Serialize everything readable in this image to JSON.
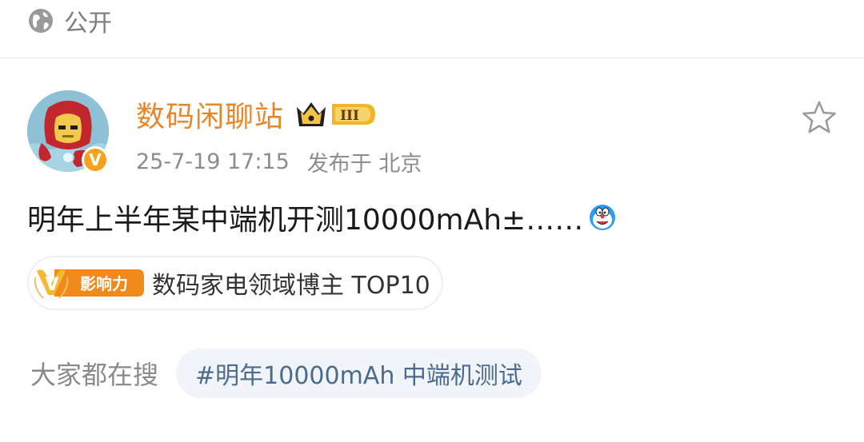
{
  "visibility": {
    "icon": "globe-icon",
    "label": "公开"
  },
  "post": {
    "author": {
      "name": "数码闲聊站",
      "avatar": "iron-man-avatar",
      "verified_icon": "verified-v-icon",
      "verified_mark": "V",
      "rank_badge_icon": "crown-rank-badge-icon",
      "rank_level": "III"
    },
    "timestamp": "25-7-19 17:15",
    "location": "发布于 北京",
    "text": "明年上半年某中端机开测10000mAh±……",
    "emoji": "doraemon-emoji",
    "favorite_icon": "star-icon",
    "influence": {
      "badge_mark": "V",
      "badge_text": "影响力",
      "label": "数码家电领域博主 TOP10"
    }
  },
  "trending": {
    "label": "大家都在搜",
    "topic": "#明年10000mAh 中端机测试"
  },
  "colors": {
    "username": "#e8862a",
    "accent_orange": "#f7a21b",
    "topic_text": "#4a6b8d",
    "topic_bg": "#f1f5f9"
  }
}
